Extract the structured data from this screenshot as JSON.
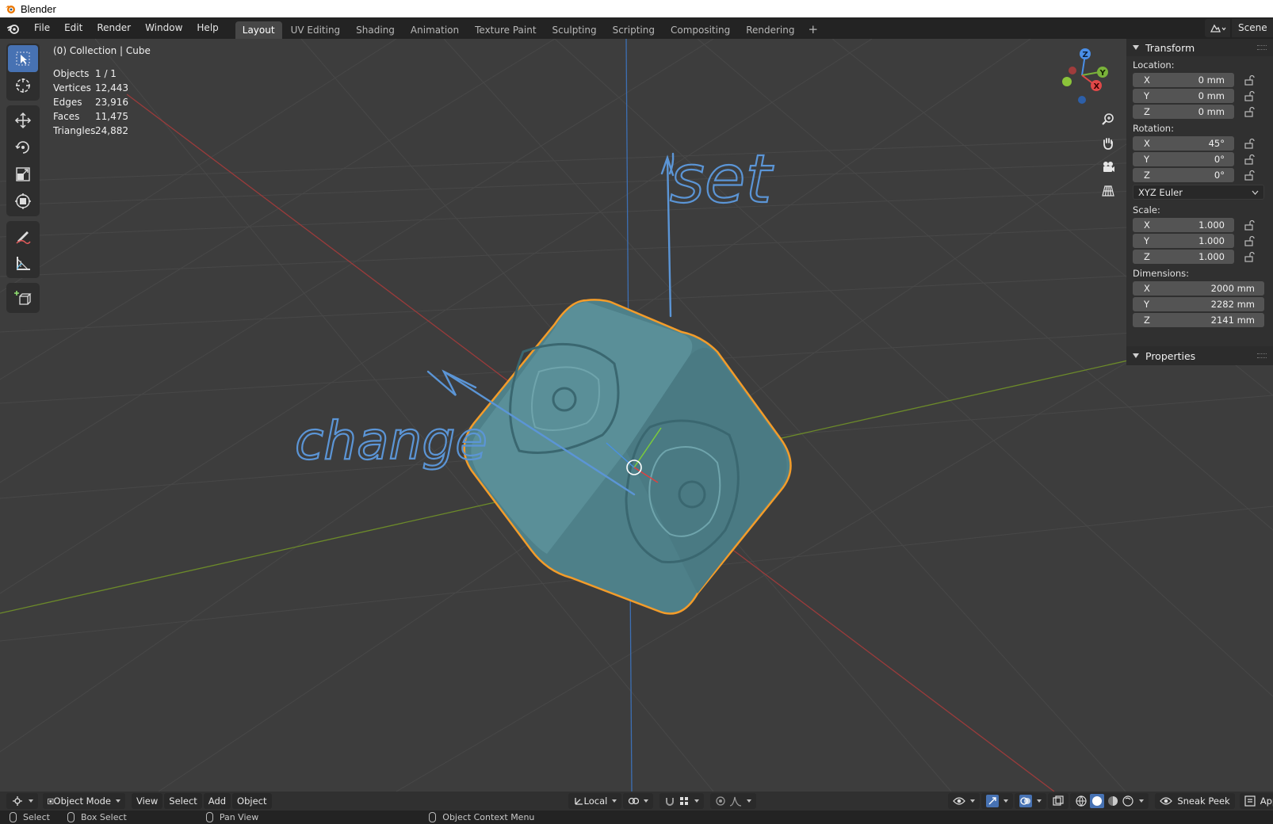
{
  "window": {
    "title": "Blender"
  },
  "menu": {
    "file": "File",
    "edit": "Edit",
    "render": "Render",
    "window": "Window",
    "help": "Help"
  },
  "workspaces": [
    {
      "label": "Layout",
      "active": true
    },
    {
      "label": "UV Editing"
    },
    {
      "label": "Shading"
    },
    {
      "label": "Animation"
    },
    {
      "label": "Texture Paint"
    },
    {
      "label": "Sculpting"
    },
    {
      "label": "Scripting"
    },
    {
      "label": "Compositing"
    },
    {
      "label": "Rendering"
    }
  ],
  "workspace_add": "+",
  "scene": {
    "name": "Scene"
  },
  "stats": {
    "collection": "(0) Collection | Cube",
    "objects_label": "Objects",
    "objects": "1 / 1",
    "vertices_label": "Vertices",
    "vertices": "12,443",
    "edges_label": "Edges",
    "edges": "23,916",
    "faces_label": "Faces",
    "faces": "11,475",
    "triangles_label": "Triangles",
    "triangles": "24,882"
  },
  "gizmo": {
    "z": "Z",
    "y": "Y",
    "x": "X"
  },
  "transform": {
    "header": "Transform",
    "location_label": "Location:",
    "location": [
      {
        "axis": "X",
        "value": "0 mm"
      },
      {
        "axis": "Y",
        "value": "0 mm"
      },
      {
        "axis": "Z",
        "value": "0 mm"
      }
    ],
    "rotation_label": "Rotation:",
    "rotation": [
      {
        "axis": "X",
        "value": "45°"
      },
      {
        "axis": "Y",
        "value": "0°"
      },
      {
        "axis": "Z",
        "value": "0°"
      }
    ],
    "rotation_mode": "XYZ Euler",
    "scale_label": "Scale:",
    "scale": [
      {
        "axis": "X",
        "value": "1.000"
      },
      {
        "axis": "Y",
        "value": "1.000"
      },
      {
        "axis": "Z",
        "value": "1.000"
      }
    ],
    "dimensions_label": "Dimensions:",
    "dimensions": [
      {
        "axis": "X",
        "value": "2000 mm"
      },
      {
        "axis": "Y",
        "value": "2282 mm"
      },
      {
        "axis": "Z",
        "value": "2141 mm"
      }
    ]
  },
  "properties": {
    "header": "Properties"
  },
  "annotations": {
    "set": "set",
    "change": "change"
  },
  "viewport_header": {
    "mode": "Object Mode",
    "view": "View",
    "select": "Select",
    "add": "Add",
    "object": "Object",
    "orientation": "Local",
    "sneak_peek": "Sneak Peek",
    "app_manager": "App Manager"
  },
  "statusbar": {
    "select": "Select",
    "box_select": "Box Select",
    "pan_view": "Pan View",
    "context_menu": "Object Context Menu"
  },
  "colors": {
    "accent": "#4772b3",
    "selection": "#f39c2a",
    "annotation": "#5b95d6",
    "mesh": "#4f8088"
  }
}
